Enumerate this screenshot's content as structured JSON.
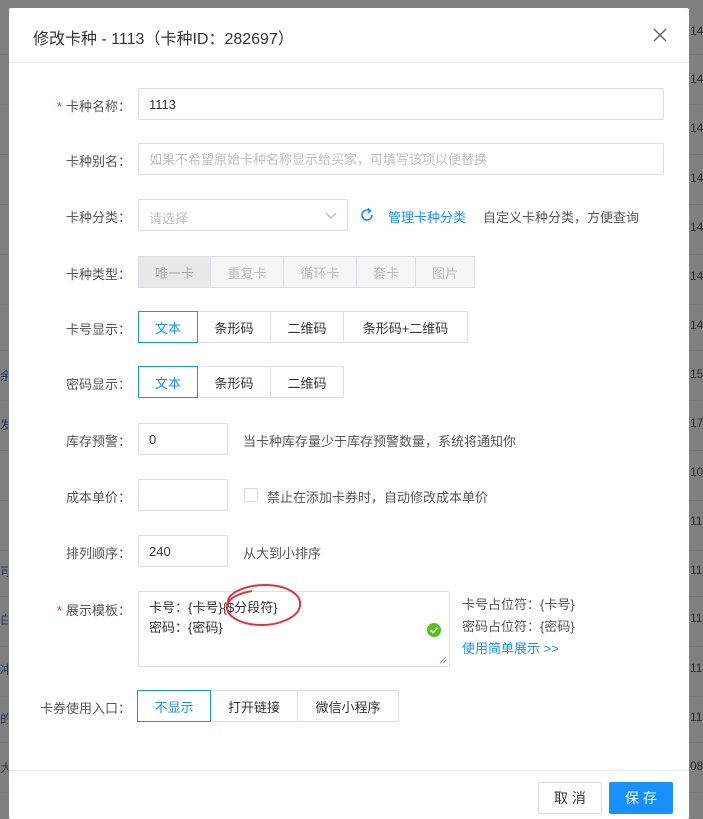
{
  "background": {
    "left_fragments": [
      "余",
      "发",
      "可",
      "白",
      "冲",
      "的",
      "大"
    ],
    "right_fragments": [
      "14",
      "14",
      "14",
      "14",
      "14",
      "14",
      "14",
      "15",
      "17",
      "10",
      "11",
      "11",
      "11",
      "11",
      "11",
      "08"
    ]
  },
  "modal": {
    "title": "修改卡种 - 1113（卡种ID：282697）"
  },
  "form": {
    "name": {
      "label": "卡种名称：",
      "value": "1113"
    },
    "alias": {
      "label": "卡种别名：",
      "placeholder": "如果不希望原始卡种名称显示给买家，可填写该项以便替换"
    },
    "category": {
      "label": "卡种分类：",
      "placeholder": "请选择",
      "manage_link": "管理卡种分类",
      "hint": "自定义卡种分类，方便查询"
    },
    "type": {
      "label": "卡种类型：",
      "options": [
        "唯一卡",
        "重复卡",
        "循环卡",
        "套卡",
        "图片"
      ]
    },
    "card_display": {
      "label": "卡号显示：",
      "options": [
        "文本",
        "条形码",
        "二维码",
        "条形码+二维码"
      ]
    },
    "password_display": {
      "label": "密码显示：",
      "options": [
        "文本",
        "条形码",
        "二维码"
      ]
    },
    "stock_warning": {
      "label": "库存预警：",
      "value": "0",
      "hint": "当卡种库存量少于库存预警数量，系统将通知你"
    },
    "cost_price": {
      "label": "成本单价：",
      "value": "",
      "checkbox_label": "禁止在添加卡券时，自动修改成本单价"
    },
    "sort_order": {
      "label": "排列顺序：",
      "value": "240",
      "hint": "从大到小排序"
    },
    "template": {
      "label": "展示模板：",
      "line1": "卡号：{卡号}{$分段符}",
      "line2": "密码：{密码}",
      "hint_card": "卡号占位符：{卡号}",
      "hint_password": "密码占位符：{密码}",
      "simple_link": "使用简单展示 >>"
    },
    "entry": {
      "label": "卡券使用入口：",
      "options": [
        "不显示",
        "打开链接",
        "微信小程序"
      ]
    }
  },
  "footer": {
    "cancel_label": "取 消",
    "save_label": "保 存"
  },
  "colors": {
    "accent": "#1890ff",
    "required": "#e0393e",
    "success": "#52c41a",
    "annotation": "#d9363e"
  }
}
